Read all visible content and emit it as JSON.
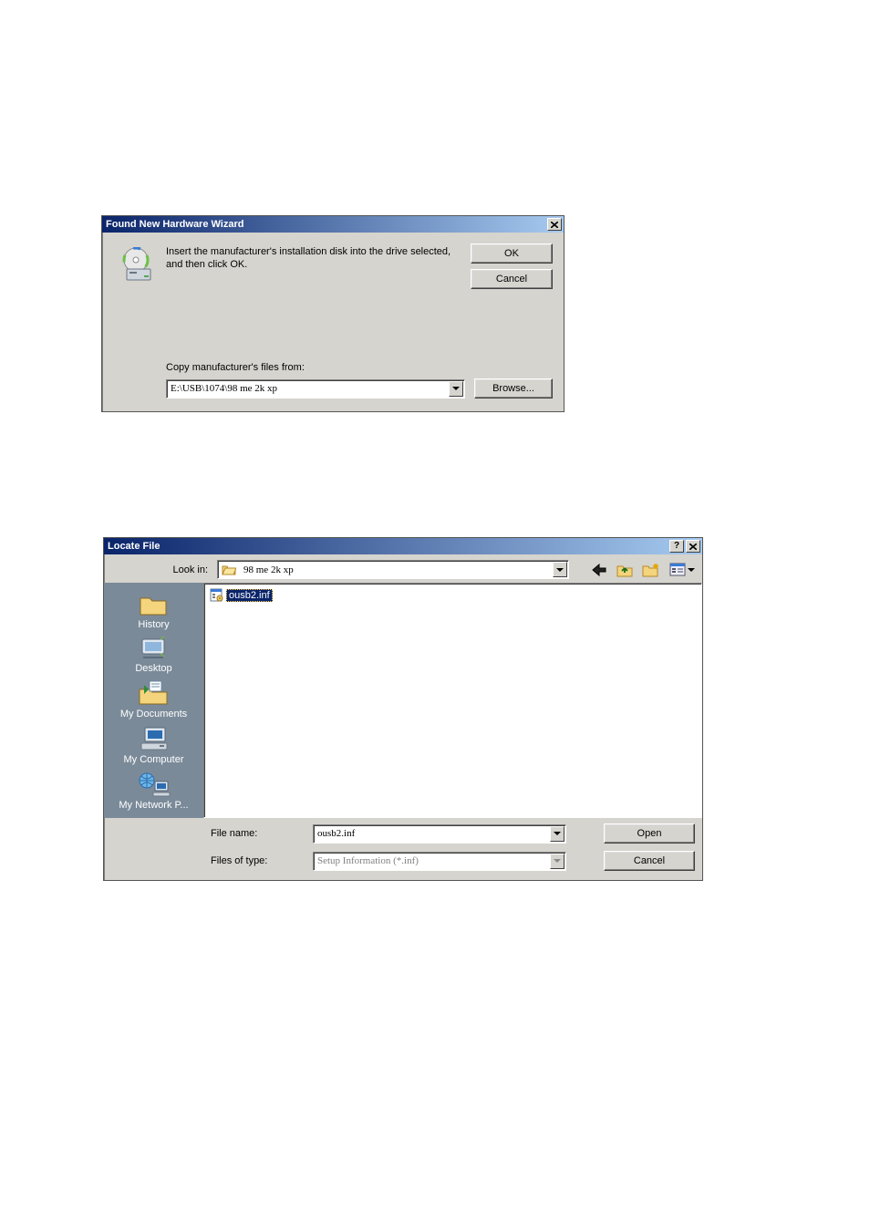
{
  "dialog1": {
    "title": "Found New Hardware Wizard",
    "message": "Insert the manufacturer's installation disk into the drive selected, and then click OK.",
    "ok_label": "OK",
    "cancel_label": "Cancel",
    "copy_from_label": "Copy manufacturer's files from:",
    "path_value": "E:\\USB\\1074\\98 me 2k xp",
    "browse_label": "Browse..."
  },
  "dialog2": {
    "title": "Locate File",
    "lookin_label": "Look in:",
    "lookin_value": "98 me 2k xp",
    "toolbar": {
      "back": "back-icon",
      "up": "up-one-level-icon",
      "new_folder": "new-folder-icon",
      "views": "views-icon"
    },
    "places": [
      {
        "name": "history",
        "label": "History"
      },
      {
        "name": "desktop",
        "label": "Desktop"
      },
      {
        "name": "mydocs",
        "label": "My Documents"
      },
      {
        "name": "mycomputer",
        "label": "My Computer"
      },
      {
        "name": "mynetwork",
        "label": "My Network P..."
      }
    ],
    "files": [
      {
        "name": "ousb2.inf",
        "selected": true
      }
    ],
    "filename_label": "File name:",
    "filename_value": "ousb2.inf",
    "filetype_label": "Files of type:",
    "filetype_value": "Setup Information (*.inf)",
    "open_label": "Open",
    "cancel_label": "Cancel"
  }
}
